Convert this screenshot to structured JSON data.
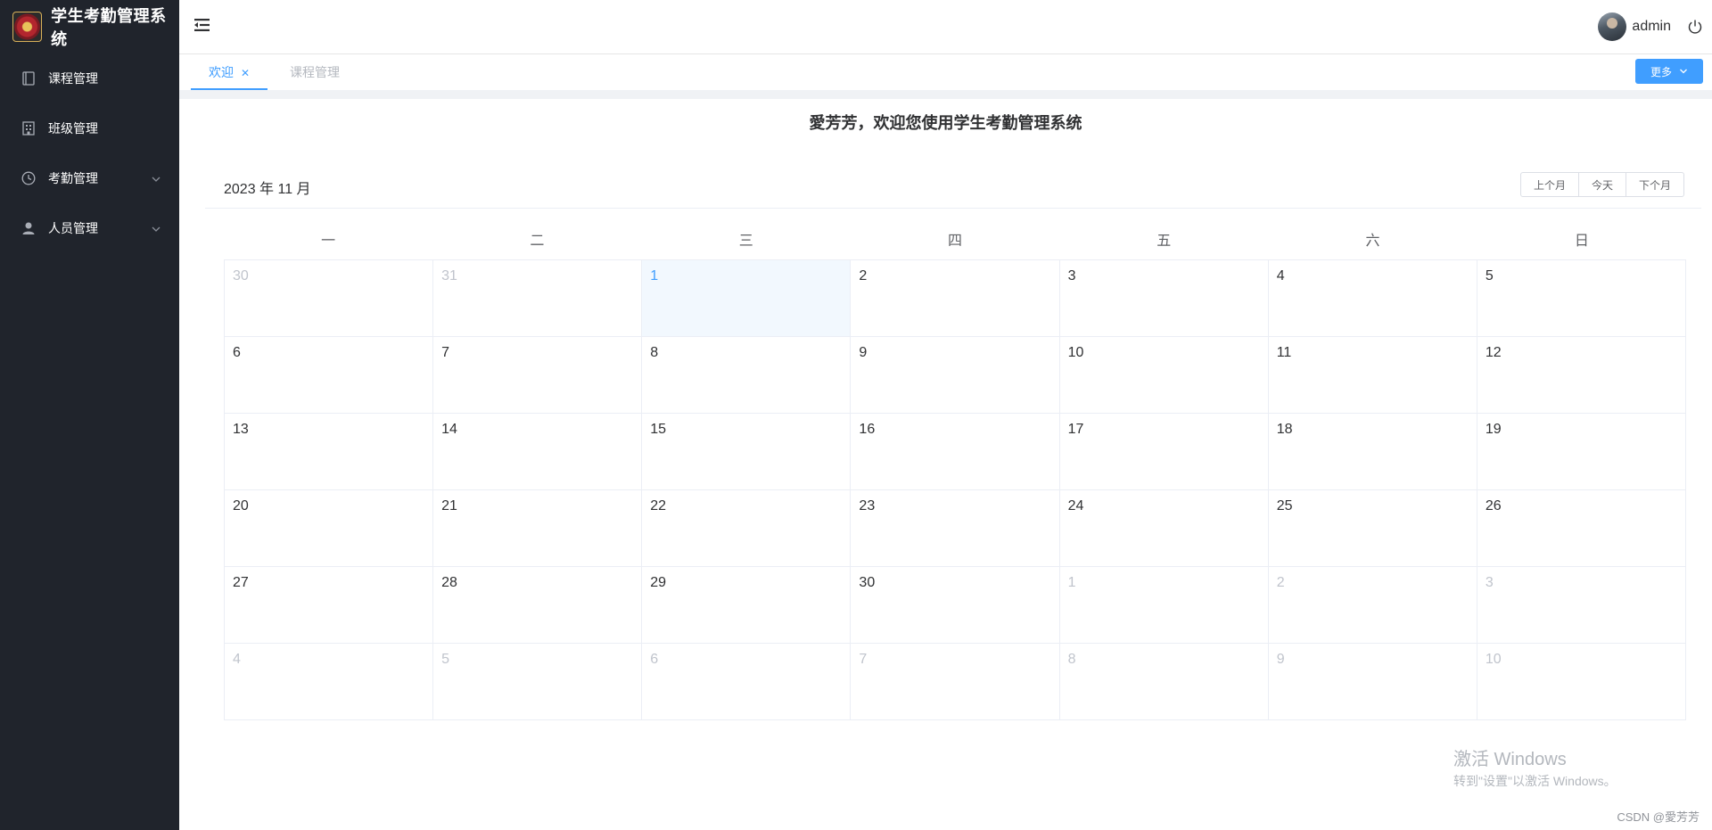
{
  "app": {
    "title": "学生考勤管理系统"
  },
  "sidebar": {
    "items": [
      {
        "label": "课程管理",
        "icon": "document-icon",
        "has_arrow": false
      },
      {
        "label": "班级管理",
        "icon": "building-icon",
        "has_arrow": false
      },
      {
        "label": "考勤管理",
        "icon": "clock-icon",
        "has_arrow": true
      },
      {
        "label": "人员管理",
        "icon": "user-icon",
        "has_arrow": true
      }
    ]
  },
  "header": {
    "username": "admin"
  },
  "tabs": [
    {
      "label": "欢迎",
      "active": true,
      "closable": true
    },
    {
      "label": "课程管理",
      "active": false,
      "closable": false
    }
  ],
  "more_button": {
    "label": "更多"
  },
  "welcome": {
    "text": "愛芳芳，欢迎您使用学生考勤管理系统"
  },
  "calendar": {
    "title": "2023 年 11 月",
    "buttons": {
      "prev": "上个月",
      "today": "今天",
      "next": "下个月"
    },
    "weekdays": [
      "一",
      "二",
      "三",
      "四",
      "五",
      "六",
      "日"
    ],
    "days": [
      {
        "d": "30",
        "cur": false
      },
      {
        "d": "31",
        "cur": false
      },
      {
        "d": "1",
        "cur": true,
        "selected": true
      },
      {
        "d": "2",
        "cur": true
      },
      {
        "d": "3",
        "cur": true
      },
      {
        "d": "4",
        "cur": true
      },
      {
        "d": "5",
        "cur": true
      },
      {
        "d": "6",
        "cur": true
      },
      {
        "d": "7",
        "cur": true
      },
      {
        "d": "8",
        "cur": true
      },
      {
        "d": "9",
        "cur": true
      },
      {
        "d": "10",
        "cur": true
      },
      {
        "d": "11",
        "cur": true
      },
      {
        "d": "12",
        "cur": true
      },
      {
        "d": "13",
        "cur": true
      },
      {
        "d": "14",
        "cur": true
      },
      {
        "d": "15",
        "cur": true
      },
      {
        "d": "16",
        "cur": true
      },
      {
        "d": "17",
        "cur": true
      },
      {
        "d": "18",
        "cur": true
      },
      {
        "d": "19",
        "cur": true
      },
      {
        "d": "20",
        "cur": true
      },
      {
        "d": "21",
        "cur": true
      },
      {
        "d": "22",
        "cur": true
      },
      {
        "d": "23",
        "cur": true
      },
      {
        "d": "24",
        "cur": true
      },
      {
        "d": "25",
        "cur": true
      },
      {
        "d": "26",
        "cur": true
      },
      {
        "d": "27",
        "cur": true
      },
      {
        "d": "28",
        "cur": true
      },
      {
        "d": "29",
        "cur": true
      },
      {
        "d": "30",
        "cur": true
      },
      {
        "d": "1",
        "cur": false
      },
      {
        "d": "2",
        "cur": false
      },
      {
        "d": "3",
        "cur": false
      },
      {
        "d": "4",
        "cur": false
      },
      {
        "d": "5",
        "cur": false
      },
      {
        "d": "6",
        "cur": false
      },
      {
        "d": "7",
        "cur": false
      },
      {
        "d": "8",
        "cur": false
      },
      {
        "d": "9",
        "cur": false
      },
      {
        "d": "10",
        "cur": false
      }
    ]
  },
  "watermark": {
    "title": "激活 Windows",
    "subtitle": "转到\"设置\"以激活 Windows。"
  },
  "footer": {
    "credit": "CSDN @愛芳芳"
  },
  "colors": {
    "sidebar_bg": "#20242c",
    "accent": "#409eff",
    "selected_day_bg": "#f2f8fe"
  }
}
